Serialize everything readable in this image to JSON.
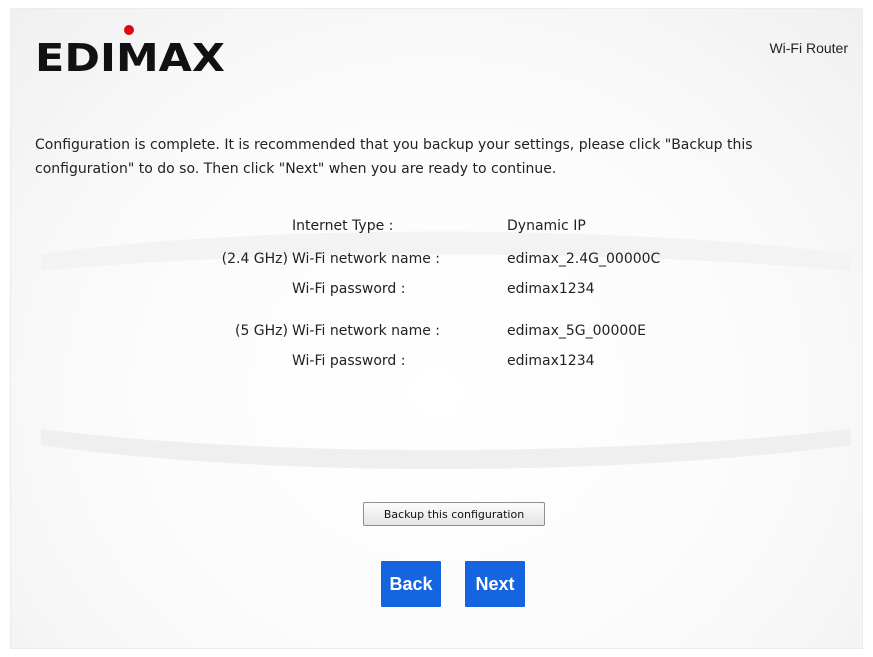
{
  "header": {
    "logo_text": "EDIMAX",
    "product_name": "Wi-Fi Router"
  },
  "intro": {
    "text": "Configuration is complete. It is recommended that you backup your settings, please click \"Backup this configuration\" to do so. Then click \"Next\" when you are ready to continue."
  },
  "summary": {
    "rows": [
      {
        "band": "",
        "label": "Internet Type :",
        "value": "Dynamic IP"
      },
      {
        "band": "(2.4 GHz)",
        "label": "Wi-Fi network name :",
        "value": "edimax_2.4G_00000C"
      },
      {
        "band": "",
        "label": "Wi-Fi password :",
        "value": "edimax1234"
      },
      {
        "band": "(5 GHz)",
        "label": "Wi-Fi network name :",
        "value": "edimax_5G_00000E"
      },
      {
        "band": "",
        "label": "Wi-Fi password :",
        "value": "edimax1234"
      }
    ]
  },
  "actions": {
    "backup_label": "Backup this configuration",
    "back_label": "Back",
    "next_label": "Next"
  },
  "colors": {
    "primary_button": "#1565e0",
    "logo_dot": "#e30613"
  }
}
